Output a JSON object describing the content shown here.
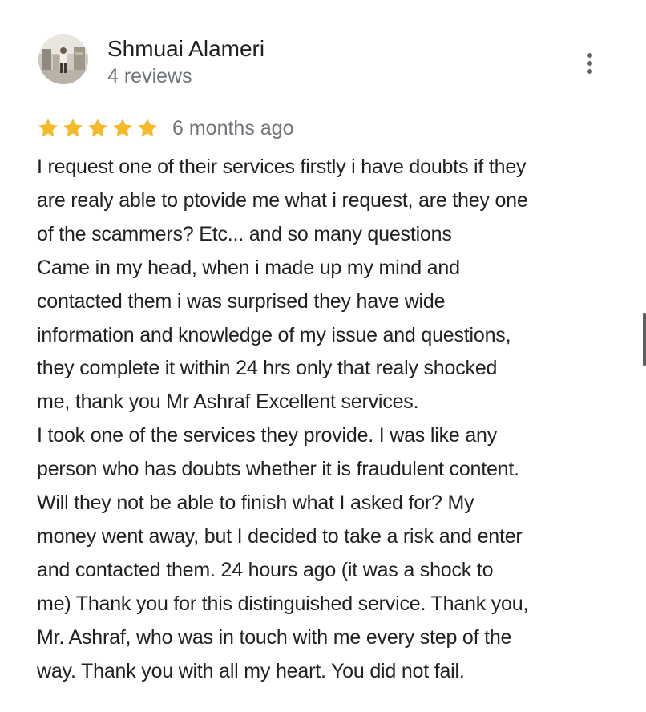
{
  "review": {
    "reviewer_name": "Shmuai Alameri",
    "review_count": "4 reviews",
    "rating": 5,
    "rating_max": 5,
    "date": "6 months ago",
    "text_lines": [
      "I request one of their services firstly i have doubts if they",
      "are realy able to ptovide me what i request, are they one",
      "of the scammers? Etc... and so many questions",
      "Came in my head, when i made up my mind and",
      "contacted them i was surprised they have wide",
      "information and knowledge of my issue and questions,",
      "they complete it within 24 hrs only that realy shocked",
      "me, thank you Mr Ashraf Excellent services.",
      "I took one of the services they provide. I was like any",
      "person who has doubts whether it is fraudulent content.",
      "Will they not be able to finish what I asked for? My",
      "money went away, but I decided to take a risk and enter",
      "and contacted them. 24 hours ago (it was a shock to",
      "me) Thank you for this distinguished service. Thank you,",
      "Mr. Ashraf, who was in touch with me every step of the",
      "way. Thank you with all my heart. You did not fail."
    ]
  },
  "icons": {
    "more": "more-vertical-icon",
    "star": "star-icon",
    "avatar": "profile-photo"
  },
  "colors": {
    "star": "#F6B92A",
    "name": "#212121",
    "secondary": "#70757A",
    "body_text": "#202124",
    "menu_dots": "#5F6368"
  }
}
